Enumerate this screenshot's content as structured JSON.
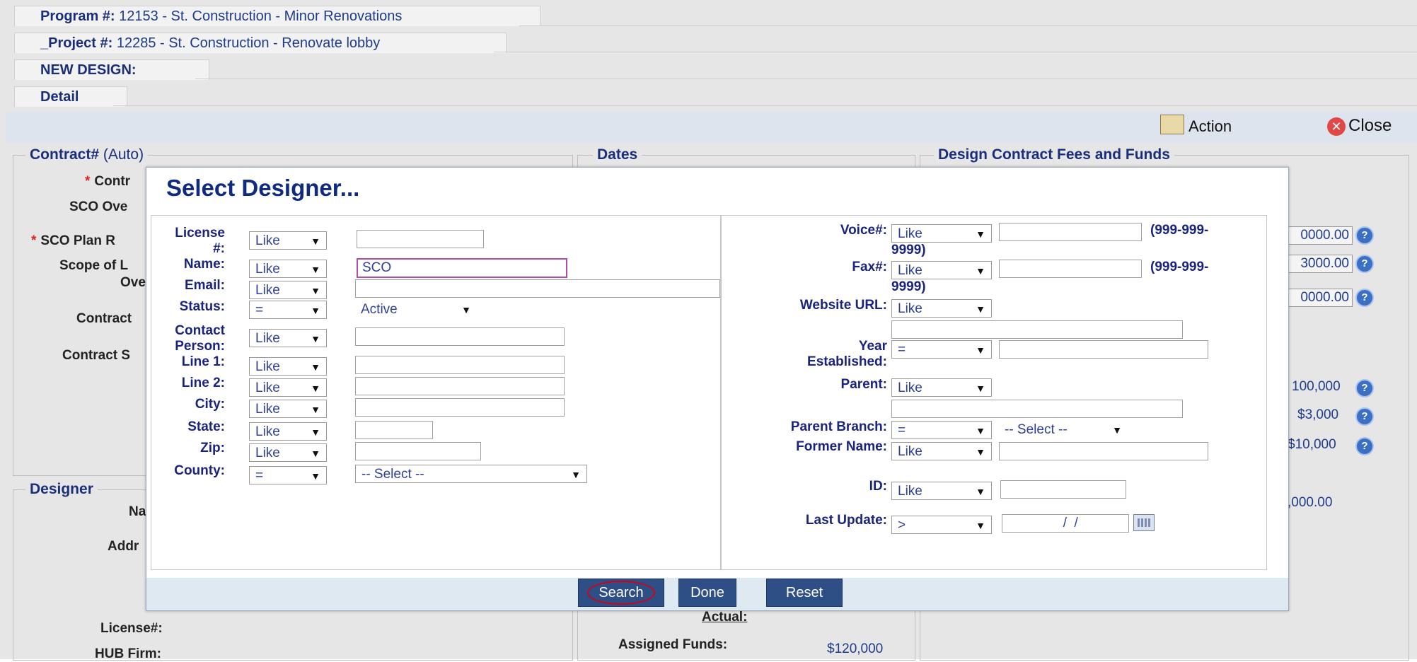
{
  "breadcrumbs": [
    {
      "bold": "Program #:",
      "rest": " 12153 - St. Construction - Minor Renovations"
    },
    {
      "bold": "_Project #:",
      "rest": " 12285 - St. Construction - Renovate lobby"
    },
    {
      "bold": "NEW DESIGN:",
      "rest": ""
    }
  ],
  "tabs": {
    "detail": "Detail"
  },
  "toolbar": {
    "action": "Action",
    "close": "Close"
  },
  "sections": {
    "contract_legend": "Contract#",
    "contract_legend_suffix": "(Auto)",
    "dates_legend": "Dates",
    "fees_legend": "Design Contract Fees and Funds",
    "designer_legend": "Designer"
  },
  "background_labels": {
    "contr": "Contr",
    "sco_ove": "SCO Ove",
    "sco_plan_r": "SCO Plan R",
    "scope_of_l": "Scope of L",
    "ove": "Ove",
    "contract": "Contract",
    "contract_s": "Contract S",
    "na": "Na",
    "addr": "Addr",
    "license": "License#:",
    "hub_firm": "HUB Firm:",
    "actual": "Actual:",
    "assigned_funds": "Assigned Funds:",
    "assigned_funds_value": "$120,000"
  },
  "background_values": {
    "fee1": "0000.00",
    "fee2": "3000.00",
    "fee3": "0000.00",
    "v1": "100,000",
    "v2": "$3,000",
    "v3": "$10,000",
    "v4": ",000.00"
  },
  "modal": {
    "title": "Select Designer...",
    "left": {
      "license": {
        "label1": "License",
        "label2": "#:",
        "op": "Like",
        "value": ""
      },
      "name": {
        "label": "Name:",
        "op": "Like",
        "value": "SCO"
      },
      "email": {
        "label": "Email:",
        "op": "Like",
        "value": ""
      },
      "status": {
        "label": "Status:",
        "op": "=",
        "value": "Active"
      },
      "contact": {
        "label1": "Contact",
        "label2": "Person:",
        "op": "Like",
        "value": ""
      },
      "line1": {
        "label": "Line 1:",
        "op": "Like",
        "value": ""
      },
      "line2": {
        "label": "Line 2:",
        "op": "Like",
        "value": ""
      },
      "city": {
        "label": "City:",
        "op": "Like",
        "value": ""
      },
      "state": {
        "label": "State:",
        "op": "Like",
        "value": ""
      },
      "zip": {
        "label": "Zip:",
        "op": "Like",
        "value": ""
      },
      "county": {
        "label": "County:",
        "op": "=",
        "value": "-- Select --"
      }
    },
    "right": {
      "voice": {
        "label": "Voice#:",
        "op": "Like",
        "hint1": "(999-999-",
        "hint2": "9999)"
      },
      "fax": {
        "label": "Fax#:",
        "op": "Like",
        "hint1": "(999-999-",
        "hint2": "9999)"
      },
      "website": {
        "label": "Website URL:",
        "op": "Like"
      },
      "year": {
        "label1": "Year",
        "label2": "Established:",
        "op": "="
      },
      "parent": {
        "label": "Parent:",
        "op": "Like"
      },
      "parent_branch": {
        "label": "Parent Branch:",
        "op": "=",
        "value": "-- Select --"
      },
      "former_name": {
        "label": "Former Name:",
        "op": "Like"
      },
      "id": {
        "label": "ID:",
        "op": "Like"
      },
      "last_update": {
        "label": "Last Update:",
        "op": ">",
        "value": "  /  /"
      }
    },
    "buttons": {
      "search": "Search",
      "done": "Done",
      "reset": "Reset"
    }
  },
  "colors": {
    "accent": "#2e4f86",
    "title": "#0f2a80",
    "highlight_ring": "#d0021b"
  }
}
